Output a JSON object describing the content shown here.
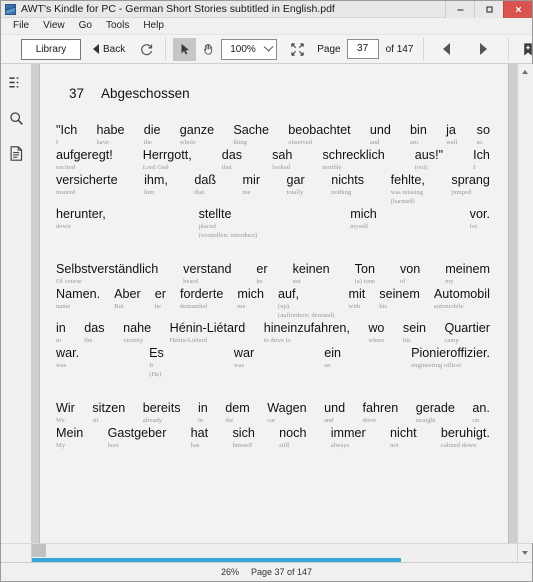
{
  "window": {
    "title": "AWT's Kindle for PC - German Short Stories subtitled in English.pdf",
    "app_icon": "kindle-app-icon",
    "minimize_label": "–",
    "maximize_label": "□",
    "close_label": "✕"
  },
  "menubar": {
    "items": [
      {
        "label": "File"
      },
      {
        "label": "View"
      },
      {
        "label": "Go"
      },
      {
        "label": "Tools"
      },
      {
        "label": "Help"
      }
    ]
  },
  "toolbar": {
    "library_label": "Library",
    "back_label": "Back",
    "refresh_icon": "refresh-icon",
    "select_tool_icon": "cursor-arrow-icon",
    "hand_tool_icon": "hand-icon",
    "zoom_value": "100%",
    "fit_icon": "fit-page-icon",
    "page_label": "Page",
    "page_value": "37",
    "page_placeholder": "37",
    "total_pages_label": "of 147",
    "prev_page_icon": "triangle-left-icon",
    "next_page_icon": "triangle-right-icon",
    "bookmark_icon": "bookmark-add-icon"
  },
  "sidebar": {
    "items": [
      {
        "icon": "table-of-contents-icon",
        "name": "contents"
      },
      {
        "icon": "search-icon",
        "name": "search"
      },
      {
        "icon": "notes-icon",
        "name": "notes"
      }
    ]
  },
  "statusbar": {
    "zoom_percent": "26%",
    "page_status": "Page 37 of 147"
  },
  "document": {
    "chapter_number": "37",
    "chapter_title": "Abgeschossen",
    "paragraphs": [
      {
        "lines": [
          [
            {
              "de": "\"Ich",
              "en": "I"
            },
            {
              "de": "habe",
              "en": "have"
            },
            {
              "de": "die",
              "en": "the"
            },
            {
              "de": "ganze",
              "en": "whole"
            },
            {
              "de": "Sache",
              "en": "thing"
            },
            {
              "de": "beobachtet",
              "en": "observed"
            },
            {
              "de": "und",
              "en": "and"
            },
            {
              "de": "bin",
              "en": "am"
            },
            {
              "de": "ja",
              "en": "well"
            },
            {
              "de": "so",
              "en": "so"
            }
          ],
          [
            {
              "de": "aufgeregt!",
              "en": "excited"
            },
            {
              "de": "Herrgott,",
              "en": "Lord God"
            },
            {
              "de": "das",
              "en": "that"
            },
            {
              "de": "sah",
              "en": "looked"
            },
            {
              "de": "schrecklich",
              "en": "terrible"
            },
            {
              "de": "aus!\"",
              "en": "(out)"
            },
            {
              "de": "Ich",
              "en": "I"
            }
          ],
          [
            {
              "de": "versicherte",
              "en": "insured"
            },
            {
              "de": "ihm,",
              "en": "him"
            },
            {
              "de": "daß",
              "en": "that"
            },
            {
              "de": "mir",
              "en": "me"
            },
            {
              "de": "gar",
              "en": "totally"
            },
            {
              "de": "nichts",
              "en": "nothing"
            },
            {
              "de": "fehlte,",
              "en": "was missing",
              "en2": "(harmed)"
            },
            {
              "de": "sprang",
              "en": "jumped"
            }
          ],
          [
            {
              "de": "herunter,",
              "en": "down"
            },
            {
              "de": "stellte",
              "en": "placed",
              "en2": "(vorstellen; introduce)"
            },
            {
              "de": "mich",
              "en": "myself"
            },
            {
              "de": "vor.",
              "en": "for"
            }
          ]
        ]
      },
      {
        "lines": [
          [
            {
              "de": "Selbstverständlich",
              "en": "Of course"
            },
            {
              "de": "verstand",
              "en": "heard"
            },
            {
              "de": "er",
              "en": "he"
            },
            {
              "de": "keinen",
              "en": "not"
            },
            {
              "de": "Ton",
              "en": "(a) tone"
            },
            {
              "de": "von",
              "en": "of"
            },
            {
              "de": "meinem",
              "en": "my"
            }
          ],
          [
            {
              "de": "Namen.",
              "en": "name"
            },
            {
              "de": "Aber",
              "en": "But"
            },
            {
              "de": "er",
              "en": "he"
            },
            {
              "de": "forderte",
              "en": "demanded"
            },
            {
              "de": "mich",
              "en": "me"
            },
            {
              "de": "auf,",
              "en": "(up)",
              "en2": "(auffordern; demand)"
            },
            {
              "de": "mit",
              "en": "with"
            },
            {
              "de": "seinem",
              "en": "his"
            },
            {
              "de": "Automobil",
              "en": "automobile"
            }
          ],
          [
            {
              "de": "in",
              "en": "in"
            },
            {
              "de": "das",
              "en": "the"
            },
            {
              "de": "nahe",
              "en": "vicinity"
            },
            {
              "de": "Hénin-Liétard",
              "en": "Hénin-Liétard"
            },
            {
              "de": "hineinzufahren,",
              "en": "to drive to"
            },
            {
              "de": "wo",
              "en": "where"
            },
            {
              "de": "sein",
              "en": "his"
            },
            {
              "de": "Quartier",
              "en": "camp"
            }
          ],
          [
            {
              "de": "war.",
              "en": "was"
            },
            {
              "de": "Es",
              "en": "It",
              "en2": "(He)"
            },
            {
              "de": "war",
              "en": "was"
            },
            {
              "de": "ein",
              "en": "an"
            },
            {
              "de": "Pionieroffizier.",
              "en": "engineering officer"
            }
          ]
        ]
      },
      {
        "lines": [
          [
            {
              "de": "Wir",
              "en": "We"
            },
            {
              "de": "sitzen",
              "en": "sit"
            },
            {
              "de": "bereits",
              "en": "already"
            },
            {
              "de": "in",
              "en": "in"
            },
            {
              "de": "dem",
              "en": "the"
            },
            {
              "de": "Wagen",
              "en": "car"
            },
            {
              "de": "und",
              "en": "and"
            },
            {
              "de": "fahren",
              "en": "drive"
            },
            {
              "de": "gerade",
              "en": "straight"
            },
            {
              "de": "an.",
              "en": "on"
            }
          ],
          [
            {
              "de": "Mein",
              "en": "My"
            },
            {
              "de": "Gastgeber",
              "en": "host"
            },
            {
              "de": "hat",
              "en": "has"
            },
            {
              "de": "sich",
              "en": "himself"
            },
            {
              "de": "noch",
              "en": "still"
            },
            {
              "de": "immer",
              "en": "always"
            },
            {
              "de": "nicht",
              "en": "not"
            },
            {
              "de": "beruhigt.",
              "en": "calmed down"
            }
          ]
        ]
      }
    ]
  },
  "colors": {
    "accent_blue": "#35a5e0",
    "close_red": "#d9534f",
    "gloss_grey": "#9a9a9a"
  }
}
